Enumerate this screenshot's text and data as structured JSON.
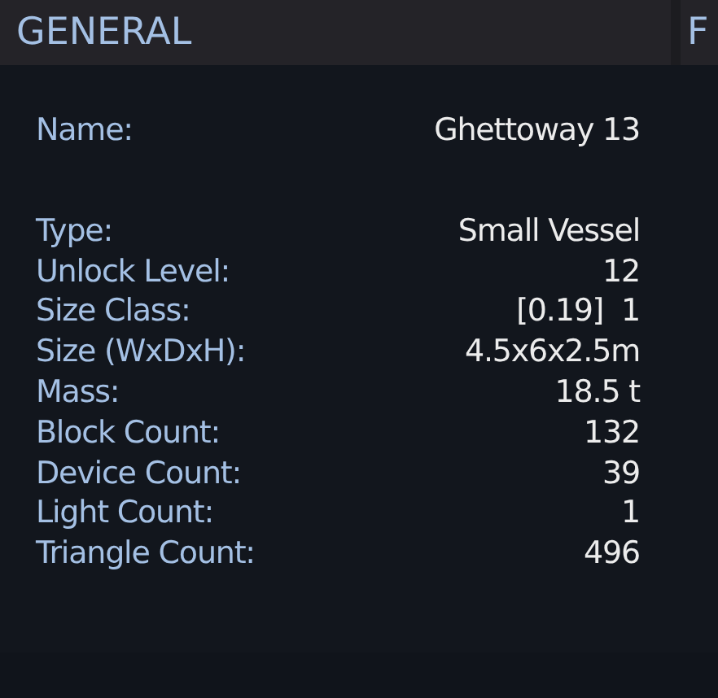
{
  "headers": [
    "GENERAL",
    "F"
  ],
  "name": {
    "label": "Name:",
    "value": "Ghettoway 13"
  },
  "stats": [
    {
      "label": "Type:",
      "value": "Small Vessel"
    },
    {
      "label": "Unlock Level:",
      "value": "12"
    },
    {
      "label": "Size Class:",
      "value": "[0.19]  1"
    },
    {
      "label": "Size (WxDxH):",
      "value": "4.5x6x2.5m"
    },
    {
      "label": "Mass:",
      "value": "18.5 t"
    },
    {
      "label": "Block Count:",
      "value": "132"
    },
    {
      "label": "Device Count:",
      "value": "39"
    },
    {
      "label": "Light Count:",
      "value": "1"
    },
    {
      "label": "Triangle Count:",
      "value": "496"
    }
  ]
}
